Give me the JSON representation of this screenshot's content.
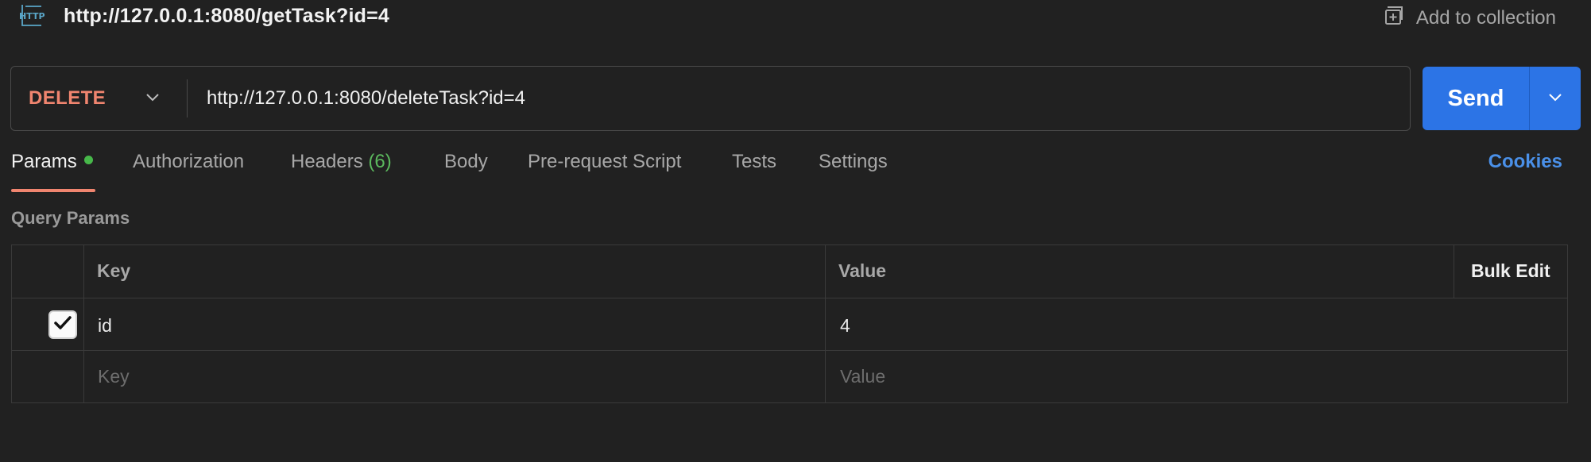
{
  "header": {
    "icon": "http-icon",
    "title": "http://127.0.0.1:8080/getTask?id=4",
    "add_to_collection": "Add to collection"
  },
  "request": {
    "method": "DELETE",
    "url": "http://127.0.0.1:8080/deleteTask?id=4",
    "send_label": "Send"
  },
  "tabs": {
    "params": "Params",
    "authorization": "Authorization",
    "headers": "Headers",
    "headers_count": "(6)",
    "body": "Body",
    "pre_request": "Pre-request Script",
    "tests": "Tests",
    "settings": "Settings",
    "cookies": "Cookies"
  },
  "params": {
    "section_title": "Query Params",
    "columns": {
      "key": "Key",
      "value": "Value",
      "bulk_edit": "Bulk Edit"
    },
    "rows": [
      {
        "checked": true,
        "key": "id",
        "value": "4"
      }
    ],
    "new_row": {
      "key_placeholder": "Key",
      "value_placeholder": "Value"
    }
  },
  "colors": {
    "method": "#f0856f",
    "send": "#2c74e6",
    "active_tab_underline": "#f0856f",
    "params_dot": "#47b84a",
    "cookies": "#4a90e8"
  }
}
